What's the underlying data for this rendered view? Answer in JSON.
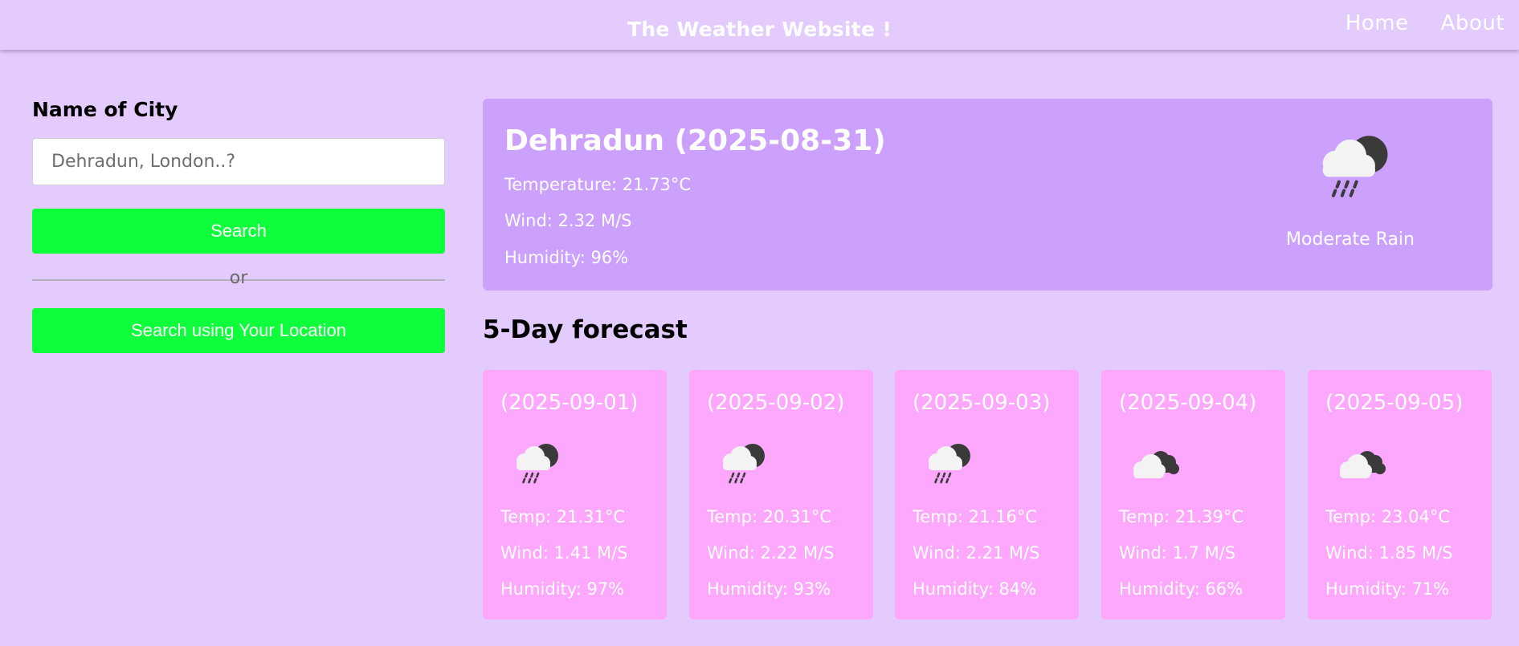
{
  "header": {
    "title": "The Weather Website !",
    "nav": [
      "Home",
      "About"
    ]
  },
  "sidebar": {
    "label": "Name of City",
    "input_placeholder": "Dehradun, London..?",
    "input_value": "",
    "search_label": "Search",
    "or_label": "or",
    "location_label": "Search using Your Location"
  },
  "current": {
    "title": "Dehradun (2025-08-31)",
    "temperature": "Temperature: 21.73°C",
    "wind": "Wind: 2.32 M/S",
    "humidity": "Humidity: 96%",
    "icon": "rain-cloud-night-icon",
    "description": "Moderate Rain"
  },
  "forecast": {
    "title": "5-Day forecast",
    "days": [
      {
        "date": "(2025-09-01)",
        "icon": "rain-cloud-night-icon",
        "temp": "Temp: 21.31°C",
        "wind": "Wind: 1.41 M/S",
        "humidity": "Humidity: 97%"
      },
      {
        "date": "(2025-09-02)",
        "icon": "rain-cloud-night-icon",
        "temp": "Temp: 20.31°C",
        "wind": "Wind: 2.22 M/S",
        "humidity": "Humidity: 93%"
      },
      {
        "date": "(2025-09-03)",
        "icon": "rain-cloud-night-icon",
        "temp": "Temp: 21.16°C",
        "wind": "Wind: 2.21 M/S",
        "humidity": "Humidity: 84%"
      },
      {
        "date": "(2025-09-04)",
        "icon": "broken-clouds-icon",
        "temp": "Temp: 21.39°C",
        "wind": "Wind: 1.7 M/S",
        "humidity": "Humidity: 66%"
      },
      {
        "date": "(2025-09-05)",
        "icon": "broken-clouds-icon",
        "temp": "Temp: 23.04°C",
        "wind": "Wind: 1.85 M/S",
        "humidity": "Humidity: 71%"
      }
    ]
  },
  "colors": {
    "background": "#e3cbfe",
    "current_card": "#cba1fd",
    "forecast_card": "#fea8fd",
    "button": "#0ffe3c"
  }
}
